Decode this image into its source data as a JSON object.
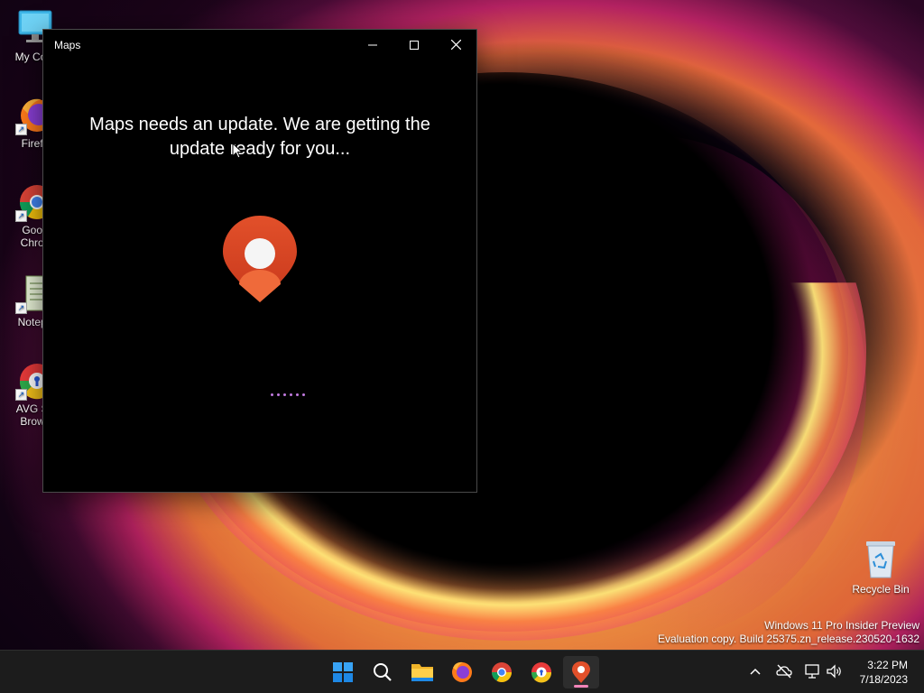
{
  "desktop": {
    "icons": [
      {
        "label": "My Com",
        "icon": "computer-icon"
      },
      {
        "label": "Firefo",
        "icon": "firefox-icon"
      },
      {
        "label": "Goog Chron",
        "line1": "Goog",
        "line2": "Chron",
        "icon": "chrome-icon"
      },
      {
        "label": "Notepa",
        "icon": "notepad-icon"
      },
      {
        "label": "AVG Se Brows",
        "line1": "AVG Se",
        "line2": "Brows",
        "icon": "avg-browser-icon"
      }
    ],
    "recycle_bin": {
      "label": "Recycle Bin",
      "icon": "recycle-bin-icon"
    }
  },
  "window": {
    "title": "Maps",
    "controls": {
      "minimize": "minimize-icon",
      "maximize": "maximize-icon",
      "close": "close-icon"
    },
    "message": "Maps needs an update. We are getting the update ready for you...",
    "logo": "maps-pin-icon",
    "loader_color": "#c27be0"
  },
  "watermark": {
    "line1": "Windows 11 Pro Insider Preview",
    "line2": "Evaluation copy. Build 25375.zn_release.230520-1632"
  },
  "taskbar": {
    "apps": [
      {
        "name": "start",
        "icon": "windows-start-icon"
      },
      {
        "name": "search",
        "icon": "search-icon"
      },
      {
        "name": "file-explorer",
        "icon": "folder-icon"
      },
      {
        "name": "firefox",
        "icon": "firefox-icon"
      },
      {
        "name": "chrome",
        "icon": "chrome-icon"
      },
      {
        "name": "avg-browser",
        "icon": "avg-browser-icon"
      },
      {
        "name": "maps",
        "icon": "maps-pin-icon",
        "active": true
      }
    ],
    "tray": {
      "icons": [
        "chevron-up-icon",
        "onedrive-icon",
        "network-icon",
        "volume-icon"
      ],
      "time": "3:22 PM",
      "date": "7/18/2023"
    },
    "colors": {
      "active_indicator": "#f184b8",
      "background": "#1c1c1c"
    }
  }
}
